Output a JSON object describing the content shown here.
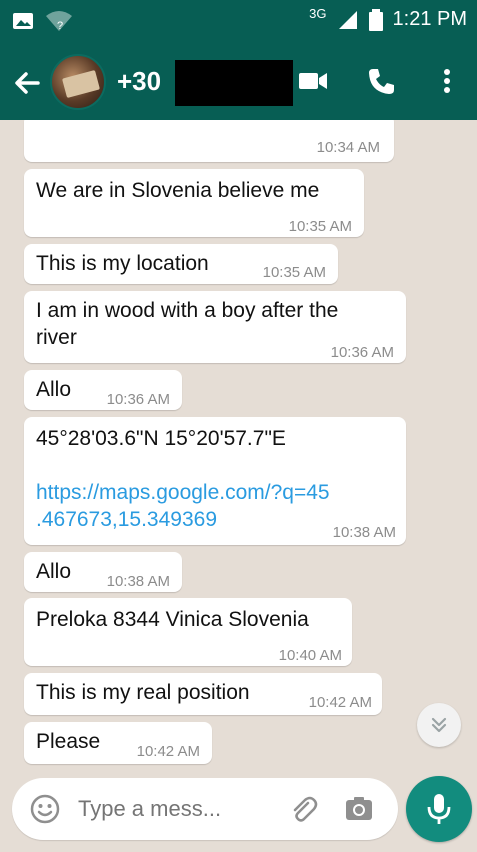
{
  "status_bar": {
    "network": "3G",
    "time": "1:21 PM"
  },
  "app_bar": {
    "contact_name": "+30"
  },
  "messages": [
    {
      "text": "",
      "time": "10:34 AM"
    },
    {
      "text": "We are in Slovenia believe me",
      "time": "10:35 AM"
    },
    {
      "text": "This is my location",
      "time": "10:35 AM"
    },
    {
      "text": "I am in wood with a boy after the\nriver",
      "time": "10:36 AM"
    },
    {
      "text": "Allo",
      "time": "10:36 AM"
    },
    {
      "text": "45°28'03.6\"N 15°20'57.7\"E",
      "link": "https://maps.google.com/?q=45\n.467673,15.349369",
      "time": "10:38 AM"
    },
    {
      "text": "Allo",
      "time": "10:38 AM"
    },
    {
      "text": "Preloka 8344 Vinica Slovenia",
      "time": "10:40 AM"
    },
    {
      "text": "This is my real position",
      "time": "10:42 AM"
    },
    {
      "text": "Please",
      "time": "10:42 AM"
    }
  ],
  "composer": {
    "placeholder": "Type a mess..."
  },
  "colors": {
    "header": "#075e54",
    "background": "#e5ddd5",
    "accent": "#128c7e",
    "link": "#2a9be0"
  },
  "icons": {
    "back": "arrow-left-icon",
    "video": "video-camera-icon",
    "call": "phone-icon",
    "more": "more-vertical-icon",
    "emoji": "emoji-icon",
    "attach": "paperclip-icon",
    "camera": "camera-icon",
    "mic": "microphone-icon",
    "scroll": "chevron-double-down-icon"
  }
}
